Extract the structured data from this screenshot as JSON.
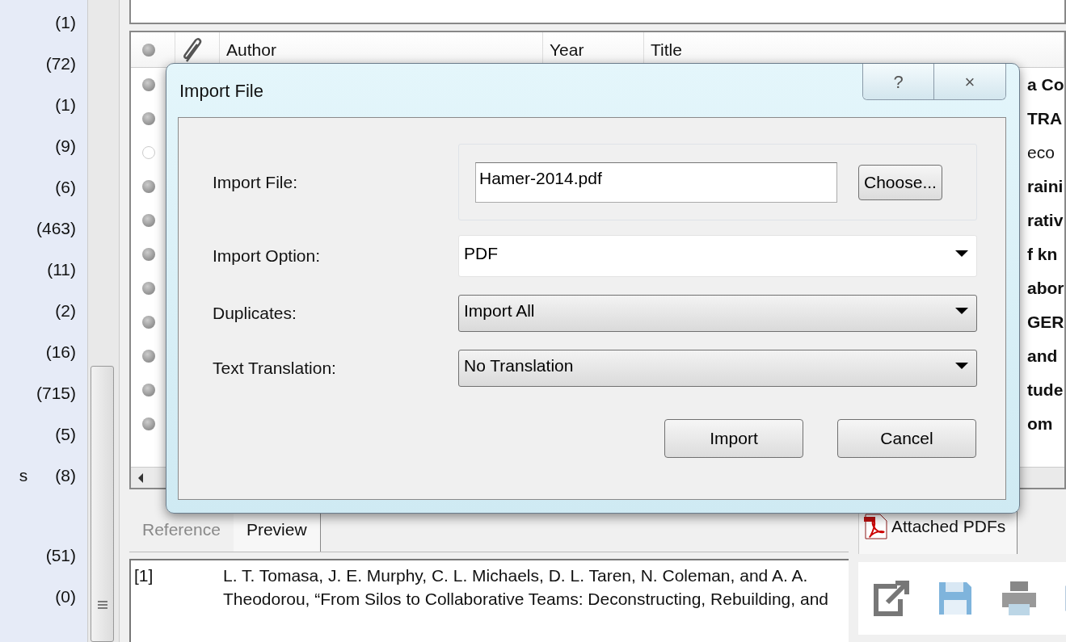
{
  "sidebar": {
    "groups": [
      {
        "count": "(1)"
      },
      {
        "count": "(72)"
      },
      {
        "count": "(1)"
      },
      {
        "count": "(9)"
      },
      {
        "count": "(6)"
      },
      {
        "count": "(463)"
      },
      {
        "count": "(11)"
      },
      {
        "count": "(2)"
      },
      {
        "count": "(16)"
      },
      {
        "count": "(715)"
      },
      {
        "count": "(5)"
      },
      {
        "name": "s",
        "count": "(8)"
      },
      {
        "count": "(51)",
        "gap_before": true
      },
      {
        "count": "(0)"
      }
    ]
  },
  "table": {
    "columns": [
      "Author",
      "Year",
      "Title"
    ],
    "rows": [
      {
        "read": false,
        "title": "a Co"
      },
      {
        "read": false,
        "title": "TRA"
      },
      {
        "read": true,
        "title": "eco"
      },
      {
        "read": false,
        "title": "raini"
      },
      {
        "read": false,
        "title": "rativ"
      },
      {
        "read": false,
        "title": "f kn"
      },
      {
        "read": false,
        "title": "abor"
      },
      {
        "read": false,
        "title": "GER"
      },
      {
        "read": false,
        "title": "and"
      },
      {
        "read": false,
        "title": "tude"
      },
      {
        "read": false,
        "title": "om"
      }
    ]
  },
  "dialog": {
    "title": "Import File",
    "help": "?",
    "close": "×",
    "file_label": "Import File:",
    "file_value": "Hamer-2014.pdf",
    "choose_button": "Choose...",
    "selects": [
      {
        "label": "Import Option:",
        "value": "PDF",
        "kind": "white"
      },
      {
        "label": "Duplicates:",
        "value": "Import All",
        "kind": "button"
      },
      {
        "label": "Text Translation:",
        "value": "No Translation",
        "kind": "button"
      }
    ],
    "buttons": [
      "Import",
      "Cancel"
    ]
  },
  "bottom_tabs": [
    {
      "label": "Reference",
      "selected": false
    },
    {
      "label": "Preview",
      "selected": true
    }
  ],
  "preview": {
    "number": "[1]",
    "text": "L. T. Tomasa, J. E. Murphy, C. L. Michaels, D. L. Taren, N. Coleman, and A. A. Theodorou, “From Silos to Collaborative Teams: Deconstructing, Rebuilding, and"
  },
  "right_panel": {
    "tab": "Attached PDFs"
  }
}
